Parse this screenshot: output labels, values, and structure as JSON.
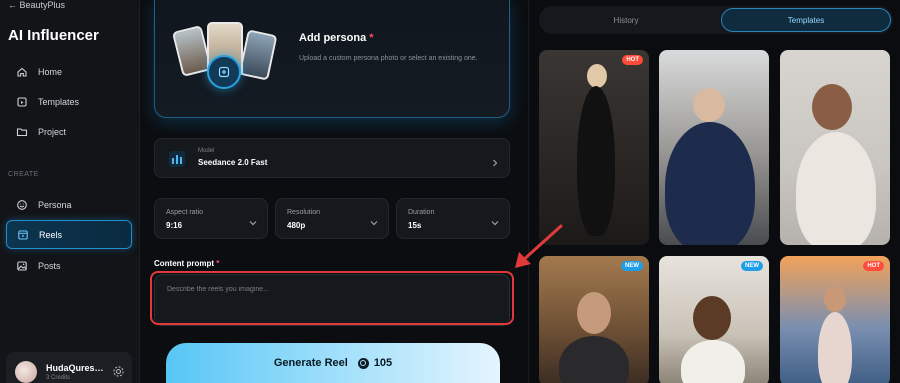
{
  "sidebar": {
    "back_label": "← BeautyPlus",
    "brand": "AI Influencer",
    "nav": [
      {
        "label": "Home",
        "icon": "home-icon"
      },
      {
        "label": "Templates",
        "icon": "templates-icon"
      },
      {
        "label": "Project",
        "icon": "folder-icon"
      }
    ],
    "section_label": "CREATE",
    "create_nav": [
      {
        "label": "Persona",
        "icon": "smile-icon"
      },
      {
        "label": "Reels",
        "icon": "video-icon",
        "active": true
      },
      {
        "label": "Posts",
        "icon": "image-icon"
      }
    ],
    "user": {
      "name": "HudaQures…",
      "credits": "3 Credits"
    }
  },
  "persona": {
    "title": "Add persona",
    "required_mark": "*",
    "description": "Upload a custom persona photo or select an existing one."
  },
  "model": {
    "label": "Model",
    "value": "Seedance 2.0 Fast"
  },
  "options": {
    "aspect": {
      "label": "Aspect ratio",
      "value": "9:16"
    },
    "resolution": {
      "label": "Resolution",
      "value": "480p"
    },
    "duration": {
      "label": "Duration",
      "value": "15s"
    }
  },
  "prompt": {
    "label": "Content prompt",
    "required_mark": "*",
    "placeholder": "Describe the reels you imagine..."
  },
  "generate": {
    "label": "Generate Reel",
    "cost": "105"
  },
  "tabs": {
    "history": "History",
    "templates": "Templates",
    "active": "Templates"
  },
  "templates": [
    {
      "badge": "HOT"
    },
    {
      "badge": ""
    },
    {
      "badge": ""
    },
    {
      "badge": "NEW"
    },
    {
      "badge": "NEW"
    },
    {
      "badge": "HOT"
    }
  ],
  "colors": {
    "accent": "#1f8fcf",
    "highlight": "#e23a3a",
    "hot_badge": "#ff4b3a",
    "new_badge": "#1e9de8"
  }
}
